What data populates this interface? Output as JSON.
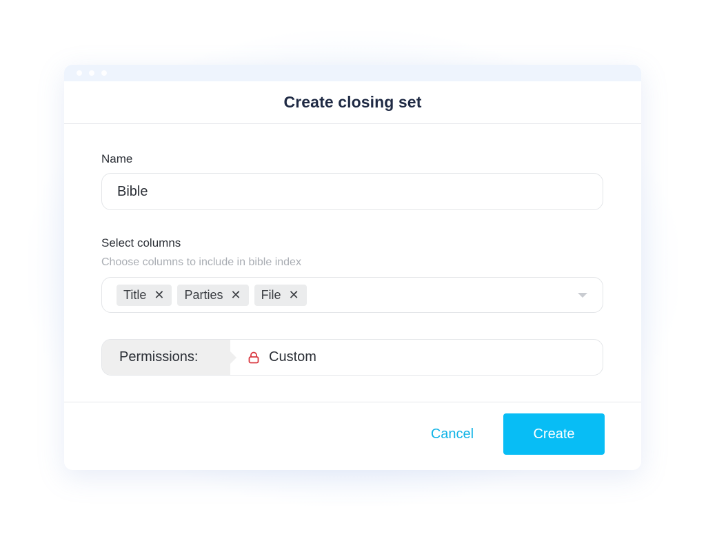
{
  "dialog": {
    "title": "Create closing set"
  },
  "name_field": {
    "label": "Name",
    "value": "Bible"
  },
  "columns_field": {
    "label": "Select columns",
    "help": "Choose columns to include in bible index",
    "chips": [
      "Title",
      "Parties",
      "File"
    ],
    "remove_glyph": "✕"
  },
  "permissions": {
    "label": "Permissions:",
    "value": "Custom",
    "icon": "lock-icon"
  },
  "footer": {
    "cancel_label": "Cancel",
    "create_label": "Create"
  },
  "colors": {
    "accent": "#08bdf5",
    "lock": "#d9363e"
  }
}
